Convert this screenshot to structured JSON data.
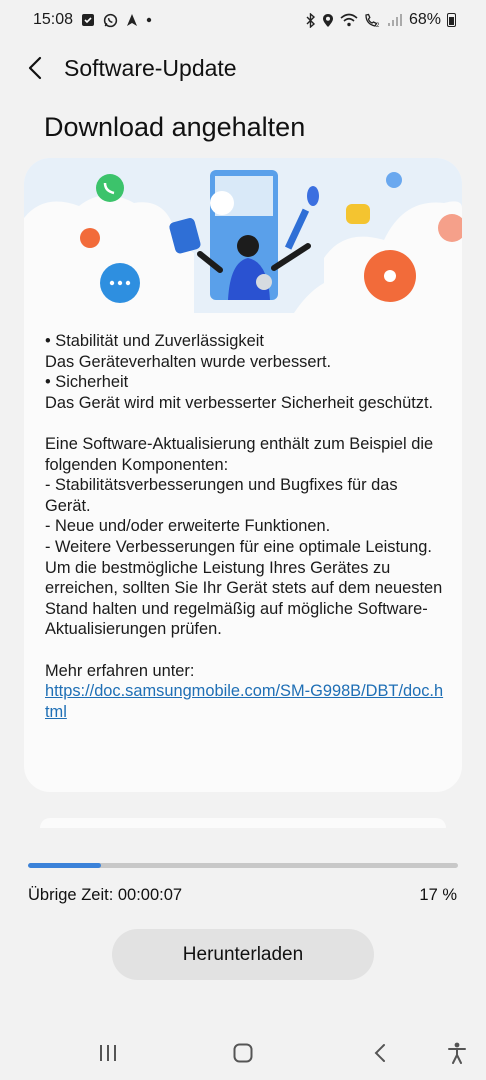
{
  "status_bar": {
    "time": "15:08",
    "battery_percent": "68%",
    "icons_left": [
      "calendar-check-icon",
      "whatsapp-icon",
      "navigation-icon",
      "dot-icon"
    ],
    "icons_right": [
      "bluetooth-icon",
      "location-icon",
      "wifi-icon",
      "call-icon",
      "signal-icon",
      "battery-icon"
    ]
  },
  "header": {
    "title": "Software-Update",
    "back_icon": "chevron-left-icon"
  },
  "page_title": "Download angehalten",
  "card": {
    "lines_1": [
      "• Stabilität und Zuverlässigkeit",
      "Das Geräteverhalten wurde verbessert.",
      "• Sicherheit",
      "Das Gerät wird mit verbesserter Sicherheit geschützt."
    ],
    "lines_2": [
      "Eine Software-Aktualisierung enthält zum Beispiel die folgenden Komponenten:",
      " - Stabilitätsverbesserungen und Bugfixes für das Gerät.",
      " - Neue und/oder erweiterte Funktionen.",
      " - Weitere Verbesserungen für eine optimale Leistung.",
      "Um die bestmögliche Leistung Ihres Gerätes zu erreichen, sollten Sie Ihr Gerät stets auf dem neuesten Stand halten und regelmäßig auf mögliche Software-Aktualisierungen prüfen."
    ],
    "more_label": "Mehr erfahren unter:",
    "link": "https://doc.samsungmobile.com/SM-G998B/DBT/doc.html"
  },
  "progress": {
    "fraction": 0.17,
    "remaining_label": "Übrige Zeit: 00:00:07",
    "percent_label": "17 %"
  },
  "download_button": "Herunterladen",
  "colors": {
    "accent": "#3b82d9",
    "link": "#1f6fb5",
    "background": "#f2f2f2",
    "card": "#fbfbfb"
  },
  "nav_bar": {
    "recents_icon": "recents-icon",
    "home_icon": "home-icon",
    "back_icon": "back-icon",
    "accessibility_icon": "accessibility-icon"
  }
}
